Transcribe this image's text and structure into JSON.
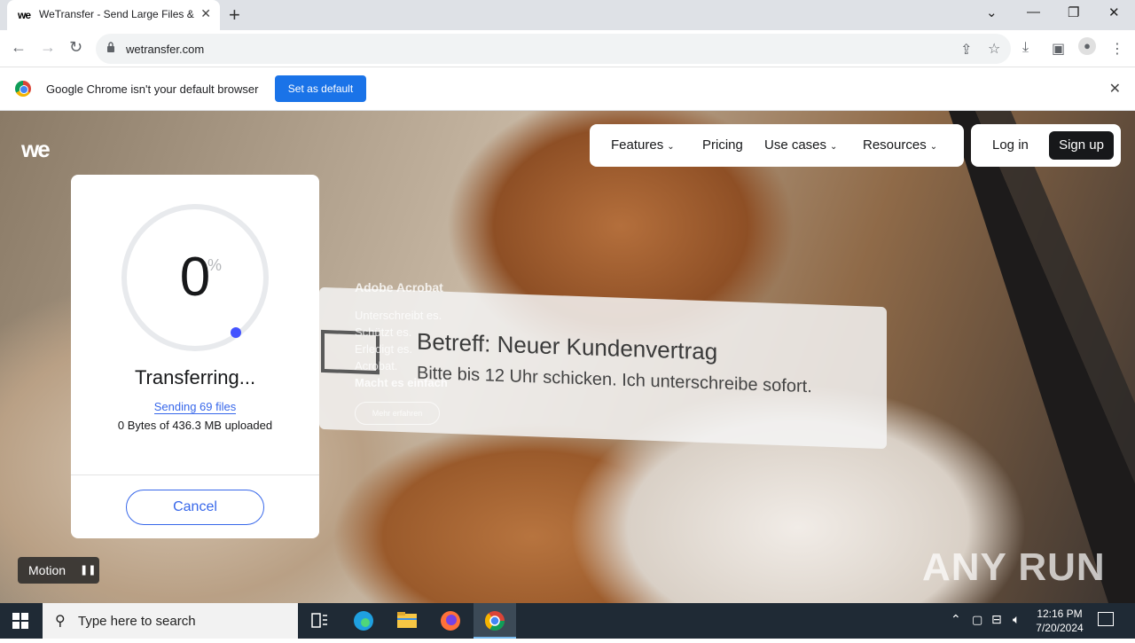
{
  "browser": {
    "tab_title": "WeTransfer - Send Large Files & Share Photos Online",
    "tab_favicon": "we",
    "url": "wetransfer.com",
    "infobar_message": "Google Chrome isn't your default browser",
    "infobar_button": "Set as default"
  },
  "site": {
    "logo": "we",
    "nav": [
      {
        "label": "Features",
        "has_dropdown": true
      },
      {
        "label": "Pricing",
        "has_dropdown": false
      },
      {
        "label": "Use cases",
        "has_dropdown": true
      },
      {
        "label": "Resources",
        "has_dropdown": true
      }
    ],
    "login": "Log in",
    "signup": "Sign up"
  },
  "background_ad": {
    "brand": "Adobe Acrobat",
    "lines": [
      "Unterschreibt es.",
      "Schützt es.",
      "Erledigt es.",
      "Acrobat.",
      "Macht es einfach"
    ],
    "subject": "Betreff: Neuer Kundenvertrag",
    "body": "Bitte bis 12 Uhr schicken. Ich unterschreibe sofort.",
    "cta": "Mehr erfahren"
  },
  "transfer": {
    "percent": "0",
    "percent_sign": "%",
    "progress_fraction": 0,
    "status": "Transferring...",
    "sending": "Sending 69 files",
    "uploaded": "0 Bytes of 436.3 MB uploaded",
    "cancel": "Cancel"
  },
  "motion": {
    "label": "Motion"
  },
  "watermark": "ANY RUN",
  "taskbar": {
    "search_placeholder": "Type here to search",
    "time": "12:16 PM",
    "date": "7/20/2024"
  },
  "colors": {
    "accent": "#3767ea",
    "chrome_blue": "#1a73e8",
    "taskbar": "#1f2a35"
  }
}
